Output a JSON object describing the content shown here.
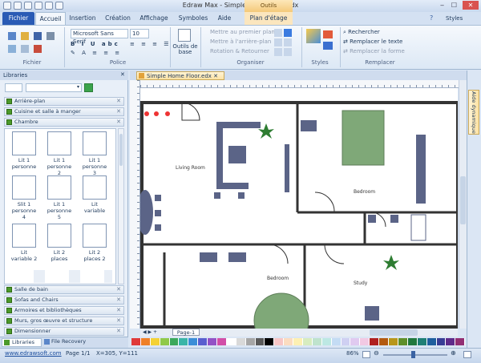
{
  "window": {
    "title": "Edraw Max - Simple Home Floor.edx",
    "context_tab": "Outils contextuels",
    "styles_label": "Styles"
  },
  "tabs": [
    "Fichier",
    "Accueil",
    "Insertion",
    "Création",
    "Affichage",
    "Symboles",
    "Aide",
    "Plan d'étage"
  ],
  "ribbon": {
    "groups": {
      "fichier": "Fichier",
      "police": "Police",
      "organiser": "Organiser",
      "styles": "Styles",
      "remplacer": "Remplacer"
    },
    "font_name": "Microsoft Sans Serif",
    "font_size": "10",
    "outils_de_base": "Outils de base",
    "organiser_items": [
      "Mettre au premier plan",
      "Mettre à l'arrière-plan",
      "Rotation & Retourner"
    ],
    "styles_btn": "Styles",
    "remplacer_items": [
      "Rechercher",
      "Remplacer le texte",
      "Remplacer la forme"
    ]
  },
  "library": {
    "header": "Libraries",
    "categories_top": [
      "Arrière-plan",
      "Cuisine et salle à manger",
      "Chambre"
    ],
    "shapes": [
      {
        "label": "Lit 1 personne"
      },
      {
        "label": "Lit 1 personne 2"
      },
      {
        "label": "Lit 1 personne 3"
      },
      {
        "label": "Slit 1 personne 4"
      },
      {
        "label": "Lit 1 personne 5"
      },
      {
        "label": "Lit variable"
      },
      {
        "label": "Lit variable 2"
      },
      {
        "label": "Lit 2 places"
      },
      {
        "label": "Lit 2 places 2"
      }
    ],
    "categories_bottom": [
      "Salle de bain",
      "Sofas and Chairs",
      "Armoires et bibliothèques",
      "Murs, gros œuvre et structure",
      "Dimensionner"
    ],
    "footer_tabs": [
      "Libraries",
      "File Recovery"
    ]
  },
  "document": {
    "tab": "Simple Home Floor.edx",
    "page_tab": "Page-1",
    "side_tab": "Aide dynamique"
  },
  "floorplan": {
    "rooms": [
      "Living Room",
      "Bedroom",
      "Bedroom",
      "Study"
    ]
  },
  "status": {
    "website": "www.edrawsoft.com",
    "page": "Page 1/1",
    "coords": "X=305, Y=111",
    "zoom": "86%"
  },
  "palette": [
    "#e03a3a",
    "#ef7f27",
    "#f4d135",
    "#90c94a",
    "#3aa85a",
    "#39b5a8",
    "#3b8ed8",
    "#5a5fcf",
    "#9352c6",
    "#d24fa8",
    "#ffffff",
    "#d9d9d9",
    "#a6a6a6",
    "#595959",
    "#000000",
    "#f7c6c6",
    "#fbdcc0",
    "#fdf0b3",
    "#d7ecbf",
    "#bfe3cd",
    "#bde8e3",
    "#c4dcf4",
    "#cfd0f2",
    "#e0caf0",
    "#f2c9e3",
    "#b02020",
    "#b35a10",
    "#b8961a",
    "#5f8f2a",
    "#21783d",
    "#1f7f75",
    "#1f5f9e",
    "#383d95",
    "#5f2b8a",
    "#922f73"
  ]
}
